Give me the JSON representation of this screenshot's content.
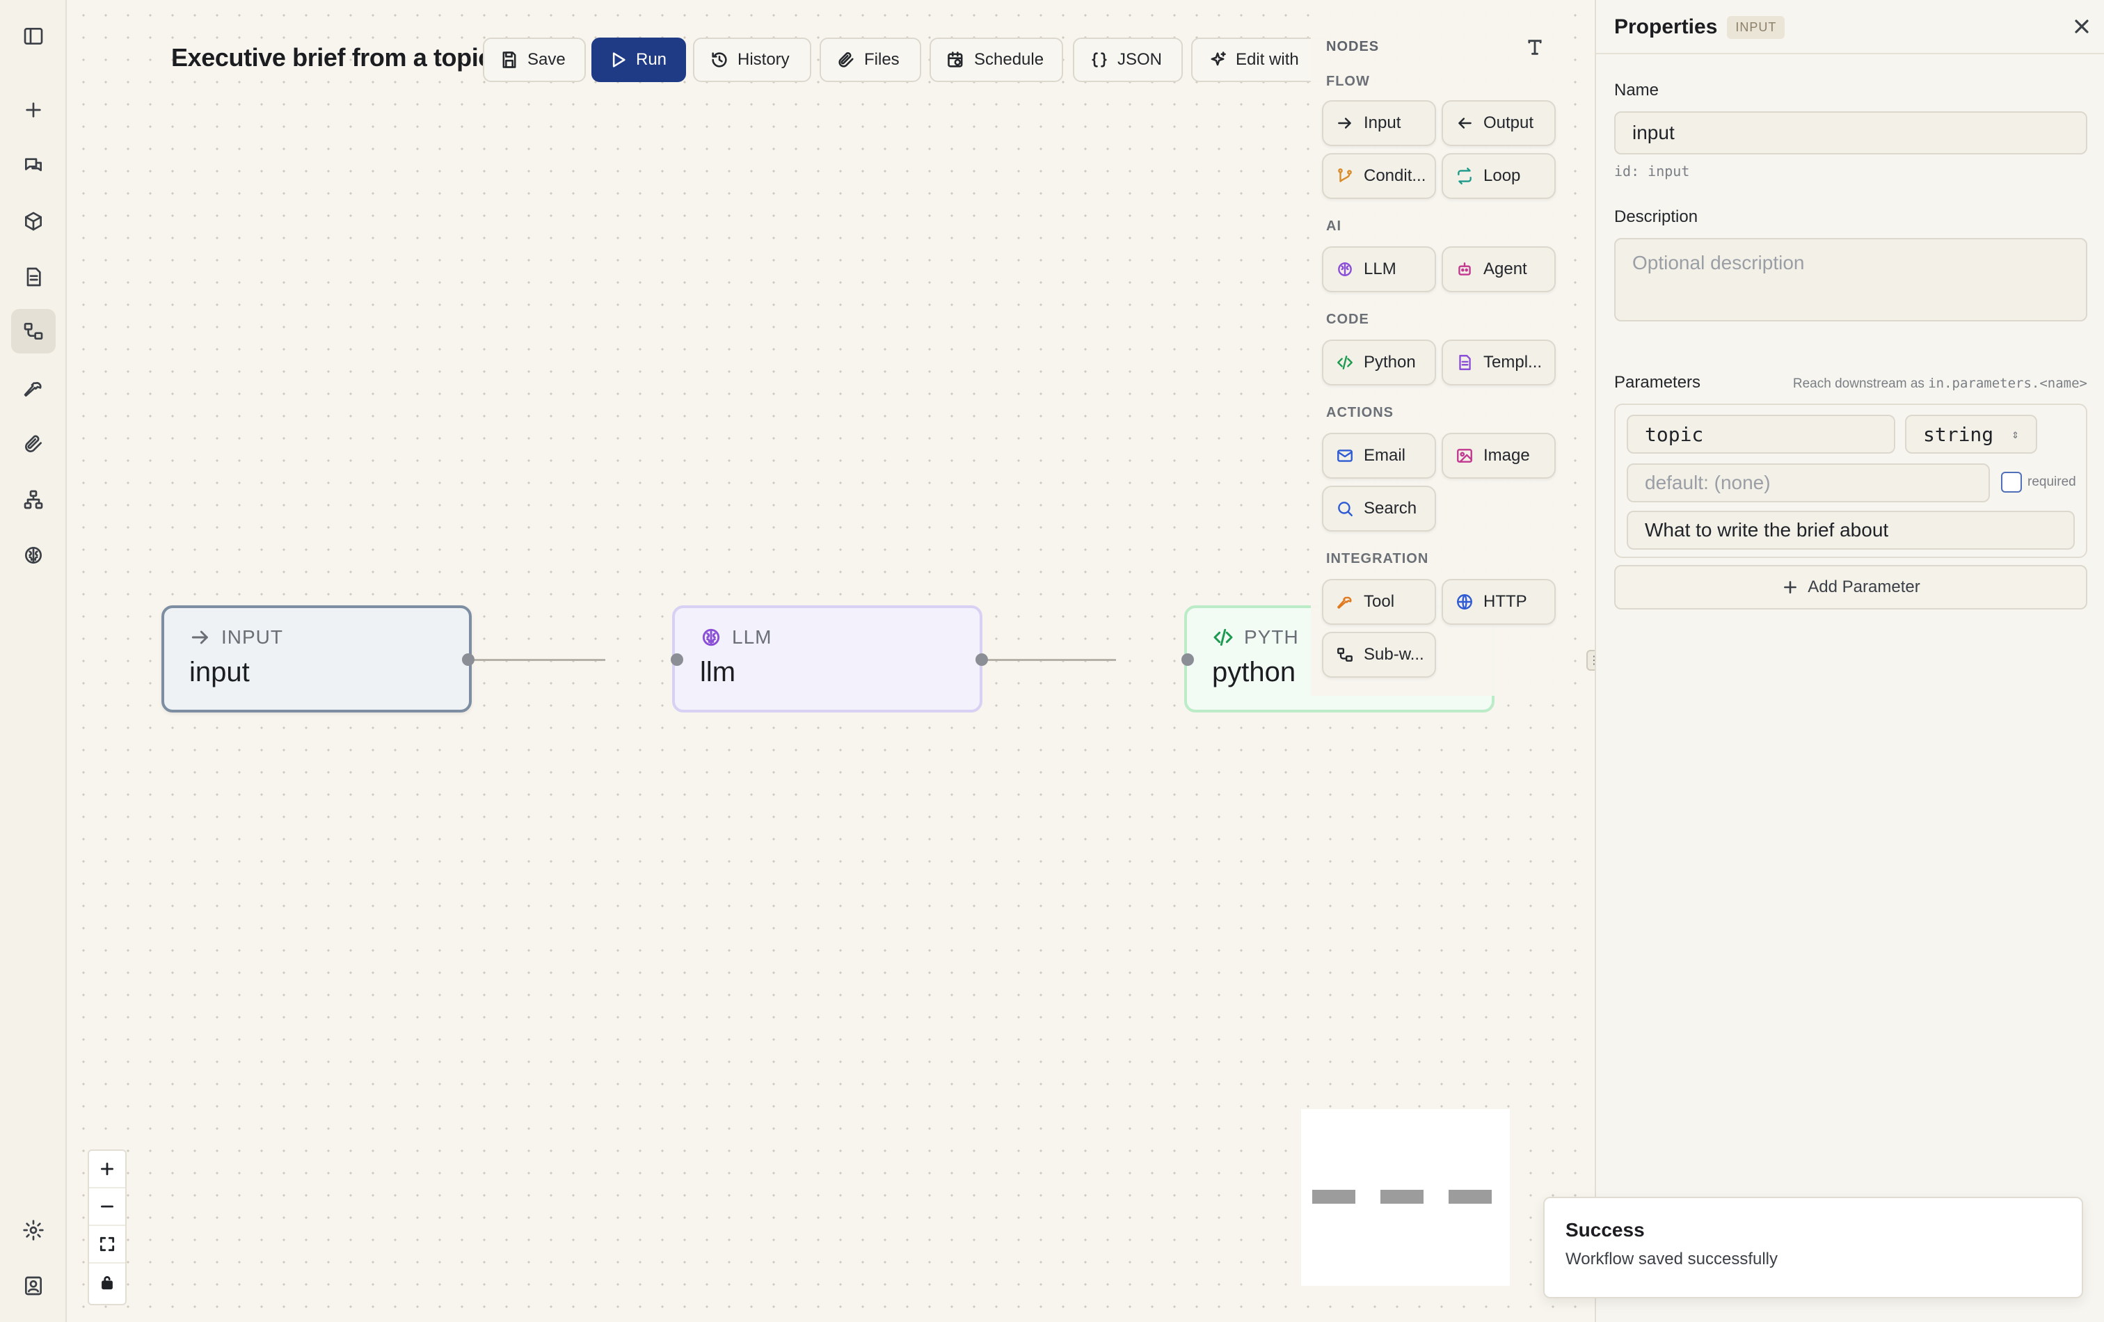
{
  "workflow": {
    "title": "Executive brief from a topic"
  },
  "toolbar": {
    "save": "Save",
    "run": "Run",
    "history": "History",
    "files": "Files",
    "schedule": "Schedule",
    "json": "JSON",
    "edit_with": "Edit with"
  },
  "rail_icons": [
    "sidebar-toggle-icon",
    "plus-icon",
    "chat-icon",
    "cube-icon",
    "document-icon",
    "workflow-icon",
    "wrench-icon",
    "paperclip-icon",
    "hierarchy-icon",
    "brain-icon",
    "settings-icon",
    "profile-icon"
  ],
  "nodes": {
    "input": {
      "kind": "INPUT",
      "name": "input"
    },
    "llm": {
      "kind": "LLM",
      "name": "llm"
    },
    "python": {
      "kind": "PYTH",
      "name": "python"
    }
  },
  "palette": {
    "header": "NODES",
    "sections": {
      "flow": "FLOW",
      "ai": "AI",
      "code": "CODE",
      "actions": "ACTIONS",
      "integration": "INTEGRATION"
    },
    "items": {
      "input": "Input",
      "output": "Output",
      "condition": "Condit...",
      "loop": "Loop",
      "llm": "LLM",
      "agent": "Agent",
      "python": "Python",
      "template": "Templ...",
      "email": "Email",
      "image": "Image",
      "search": "Search",
      "tool": "Tool",
      "http": "HTTP",
      "subworkflow": "Sub-w..."
    }
  },
  "properties": {
    "title": "Properties",
    "badge": "INPUT",
    "name_label": "Name",
    "name_value": "input",
    "id_text": "id: input",
    "description_label": "Description",
    "description_placeholder": "Optional description",
    "parameters_label": "Parameters",
    "parameters_hint_prefix": "Reach downstream as",
    "parameters_hint_code": "in.parameters.<name>",
    "param": {
      "name": "topic",
      "type": "string",
      "default_placeholder": "default: (none)",
      "required_label": "required",
      "description": "What to write the brief about"
    },
    "add_parameter": "Add Parameter"
  },
  "toast": {
    "title": "Success",
    "message": "Workflow saved successfully"
  },
  "colors": {
    "primary": "#1f3b86",
    "llm_accent": "#8a4fd6",
    "python_accent": "#1d9a50",
    "input_border": "#7d8ea3"
  }
}
